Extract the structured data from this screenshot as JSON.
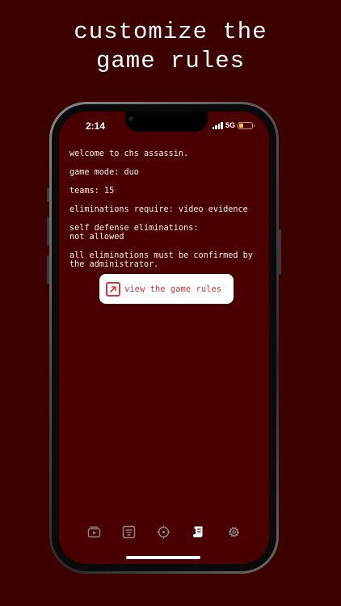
{
  "headline": {
    "line1": "customize the",
    "line2": "game rules"
  },
  "status_bar": {
    "time": "2:14",
    "network": "5G",
    "battery_level": 0.3
  },
  "content": {
    "welcome": "welcome to chs assassin.",
    "game_mode": "game mode: duo",
    "teams": "teams: 15",
    "eliminations": "eliminations require: video evidence",
    "self_defense": "self defense eliminations:\nnot allowed",
    "confirmation": "all eliminations must be confirmed by the administrator."
  },
  "rules_button": {
    "label": "view the game rules",
    "icon": "external-link-icon"
  },
  "tabbar": {
    "items": [
      {
        "name": "video-feed",
        "icon": "video-icon",
        "active": false
      },
      {
        "name": "list",
        "icon": "list-icon",
        "active": false
      },
      {
        "name": "target",
        "icon": "crosshair-icon",
        "active": false
      },
      {
        "name": "rules",
        "icon": "scroll-icon",
        "active": true
      },
      {
        "name": "settings",
        "icon": "gear-icon",
        "active": false
      }
    ]
  },
  "colors": {
    "background": "#3d0000",
    "screen": "#4a0000",
    "accent": "#d9363e",
    "tab_inactive": "#8c8c8c"
  }
}
